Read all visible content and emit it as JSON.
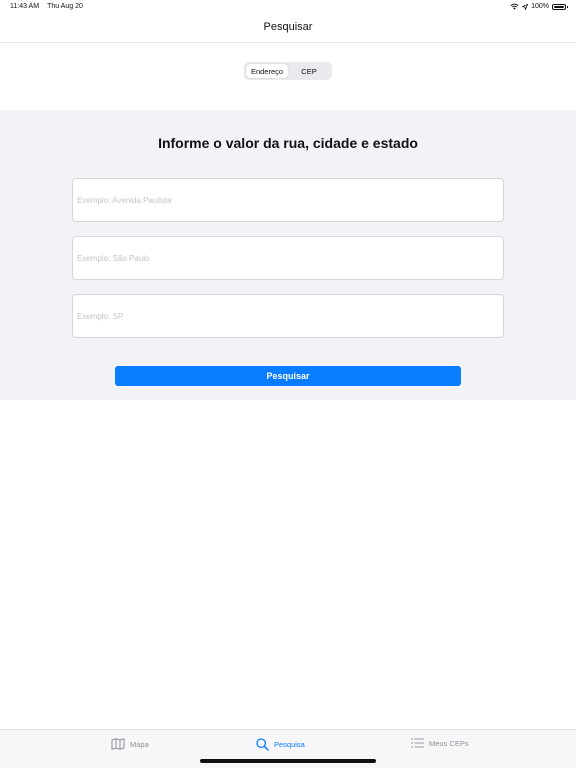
{
  "status_bar": {
    "time": "11:43 AM",
    "date": "Thu Aug 20",
    "battery": "100%",
    "icons": [
      "wifi-icon",
      "location-icon",
      "battery-icon"
    ]
  },
  "nav": {
    "title": "Pesquisar"
  },
  "segmented": {
    "options": [
      "Endereço",
      "CEP"
    ],
    "selected": "Endereço"
  },
  "form": {
    "heading": "Informe o valor da rua, cidade e estado",
    "street": {
      "value": "",
      "placeholder": "Exemplo: Avenida Paulista"
    },
    "city": {
      "value": "",
      "placeholder": "Exemplo: São Paulo"
    },
    "state": {
      "value": "",
      "placeholder": "Exemplo: SP"
    },
    "submit_label": "Pesquisar"
  },
  "tab_bar": {
    "items": [
      {
        "label": "Mapa",
        "icon": "map-icon",
        "active": false
      },
      {
        "label": "Pesquisa",
        "icon": "search-icon",
        "active": true
      },
      {
        "label": "Meus CEPs",
        "icon": "list-icon",
        "active": false
      }
    ]
  },
  "colors": {
    "accent": "#0a7cff",
    "panel_background": "#f2f2f7",
    "inactive_tab": "#8e8e93"
  }
}
